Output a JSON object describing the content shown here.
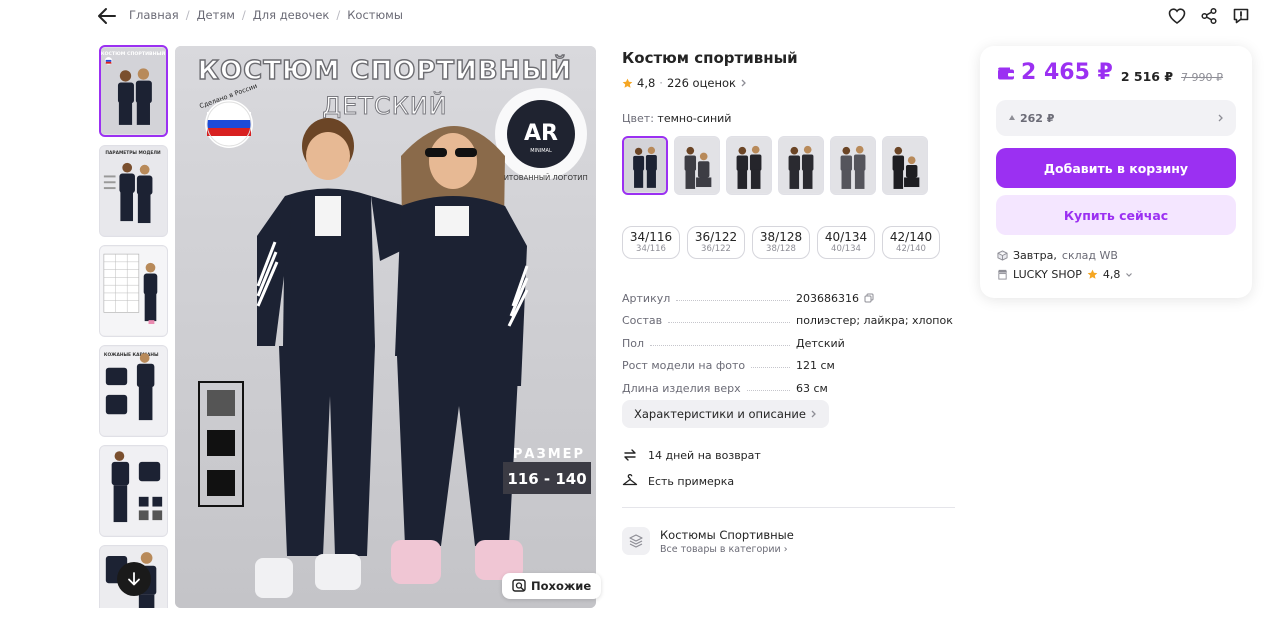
{
  "breadcrumbs": [
    "Главная",
    "Детям",
    "Для девочек",
    "Костюмы"
  ],
  "gallery": {
    "main_image": {
      "headline": "КОСТЮМ СПОРТИВНЫЙ",
      "subheadline": "ДЕТСКИЙ",
      "badge_text": "Сделано в России",
      "logo_text": "AR",
      "logo_sub": "MINIMAL",
      "logo_ring_text": "ПРИТОВАННЫЙ ЛОГОТИП",
      "size_label": "РАЗМЕР",
      "size_range": "116 - 140"
    },
    "similar_label": "Похожие",
    "thumb_labels": [
      "КОСТЮМ СПОРТИВНЫЙ",
      "ПАРАМЕТРЫ МОДЕЛИ",
      "",
      "КОЖАНЫЕ КАРМАНЫ",
      "",
      ""
    ]
  },
  "product": {
    "title": "Костюм спортивный",
    "rating": "4,8",
    "reviews": "226 оценок",
    "color_label": "Цвет:",
    "color_value": "темно-синий",
    "sizes": [
      {
        "main": "34/116",
        "sub": "34/116"
      },
      {
        "main": "36/122",
        "sub": "36/122"
      },
      {
        "main": "38/128",
        "sub": "38/128"
      },
      {
        "main": "40/134",
        "sub": "40/134"
      },
      {
        "main": "42/140",
        "sub": "42/140"
      }
    ],
    "specs": [
      {
        "key": "Артикул",
        "value": "203686316"
      },
      {
        "key": "Состав",
        "value": "полиэстер; лайкра; хлопок"
      },
      {
        "key": "Пол",
        "value": "Детский"
      },
      {
        "key": "Рост модели на фото",
        "value": "121 см"
      },
      {
        "key": "Длина изделия верх",
        "value": "63 см"
      }
    ],
    "characteristics_button": "Характеристики и описание",
    "features": [
      "14 дней на возврат",
      "Есть примерка"
    ],
    "category": {
      "name": "Костюмы Спортивные",
      "link": "Все товары в категории"
    }
  },
  "buy": {
    "price": "2 465 ₽",
    "price_without_wallet": "2 516 ₽",
    "old_price": "7 990 ₽",
    "credit_text": "262 ₽",
    "add_to_cart": "Добавить в корзину",
    "buy_now": "Купить сейчас",
    "delivery_day": "Завтра,",
    "delivery_warehouse": "склад WB",
    "seller_name": "LUCKY SHOP",
    "seller_rating": "4,8"
  },
  "colors": {
    "accent": "#9b30f2",
    "accent_light": "#f4e6ff",
    "star": "#f5a623"
  }
}
